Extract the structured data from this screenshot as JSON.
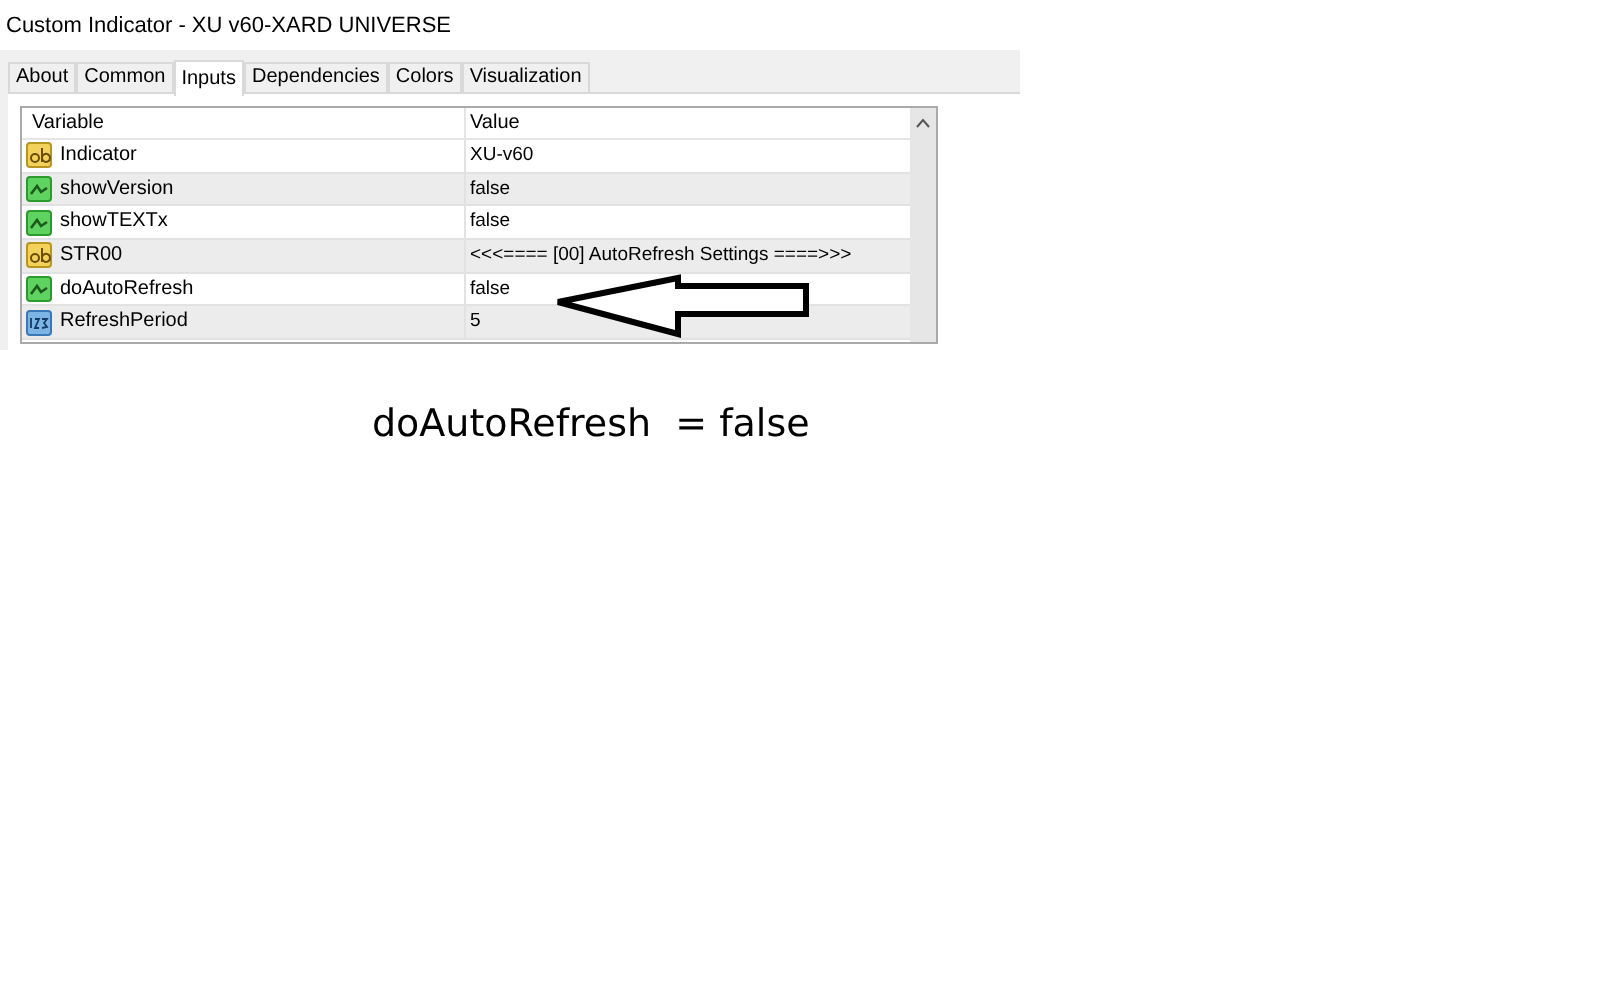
{
  "window": {
    "title": "Custom Indicator - XU v60-XARD UNIVERSE"
  },
  "tabs": [
    {
      "label": "About",
      "selected": false
    },
    {
      "label": "Common",
      "selected": false
    },
    {
      "label": "Inputs",
      "selected": true
    },
    {
      "label": "Dependencies",
      "selected": false
    },
    {
      "label": "Colors",
      "selected": false
    },
    {
      "label": "Visualization",
      "selected": false
    }
  ],
  "table": {
    "columns": [
      "Variable",
      "Value"
    ],
    "rows": [
      {
        "kind": "string",
        "variable": "Indicator",
        "value": "XU-v60"
      },
      {
        "kind": "bool",
        "variable": "showVersion",
        "value": "false"
      },
      {
        "kind": "bool",
        "variable": "showTEXTx",
        "value": "false"
      },
      {
        "kind": "string",
        "variable": "STR00",
        "value": "<<<==== [00] AutoRefresh Settings ====>>>"
      },
      {
        "kind": "bool",
        "variable": "doAutoRefresh",
        "value": "false"
      },
      {
        "kind": "int",
        "variable": "RefreshPeriod",
        "value": "5"
      }
    ]
  },
  "caption": "doAutoRefresh  = false"
}
